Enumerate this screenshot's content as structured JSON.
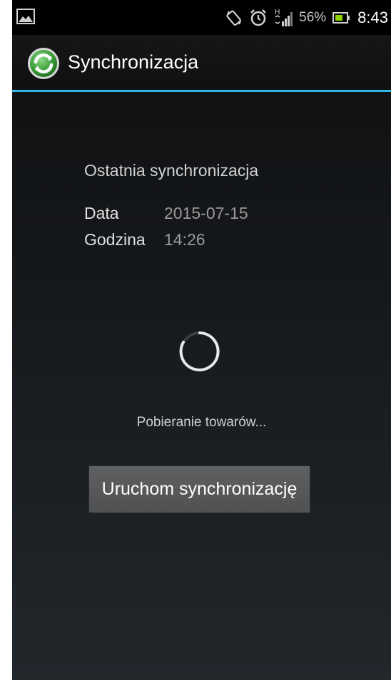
{
  "status_bar": {
    "left_icon": "gallery-notification-icon",
    "icons": [
      "screen-rotation-icon",
      "alarm-icon",
      "signal-hspa-icon",
      "battery-icon"
    ],
    "battery_percent": "56%",
    "time": "8:43",
    "battery_color": "#8ed400"
  },
  "action_bar": {
    "app_icon": "sync-app-icon",
    "title": "Synchronizacja",
    "accent_color": "#33b5e5"
  },
  "last_sync": {
    "heading": "Ostatnia synchronizacja",
    "date_label": "Data",
    "date_value": "2015-07-15",
    "time_label": "Godzina",
    "time_value": "14:26"
  },
  "progress": {
    "spinner_icon": "loading-spinner-icon",
    "text": "Pobieranie towarów..."
  },
  "actions": {
    "start_sync_label": "Uruchom synchronizację"
  }
}
